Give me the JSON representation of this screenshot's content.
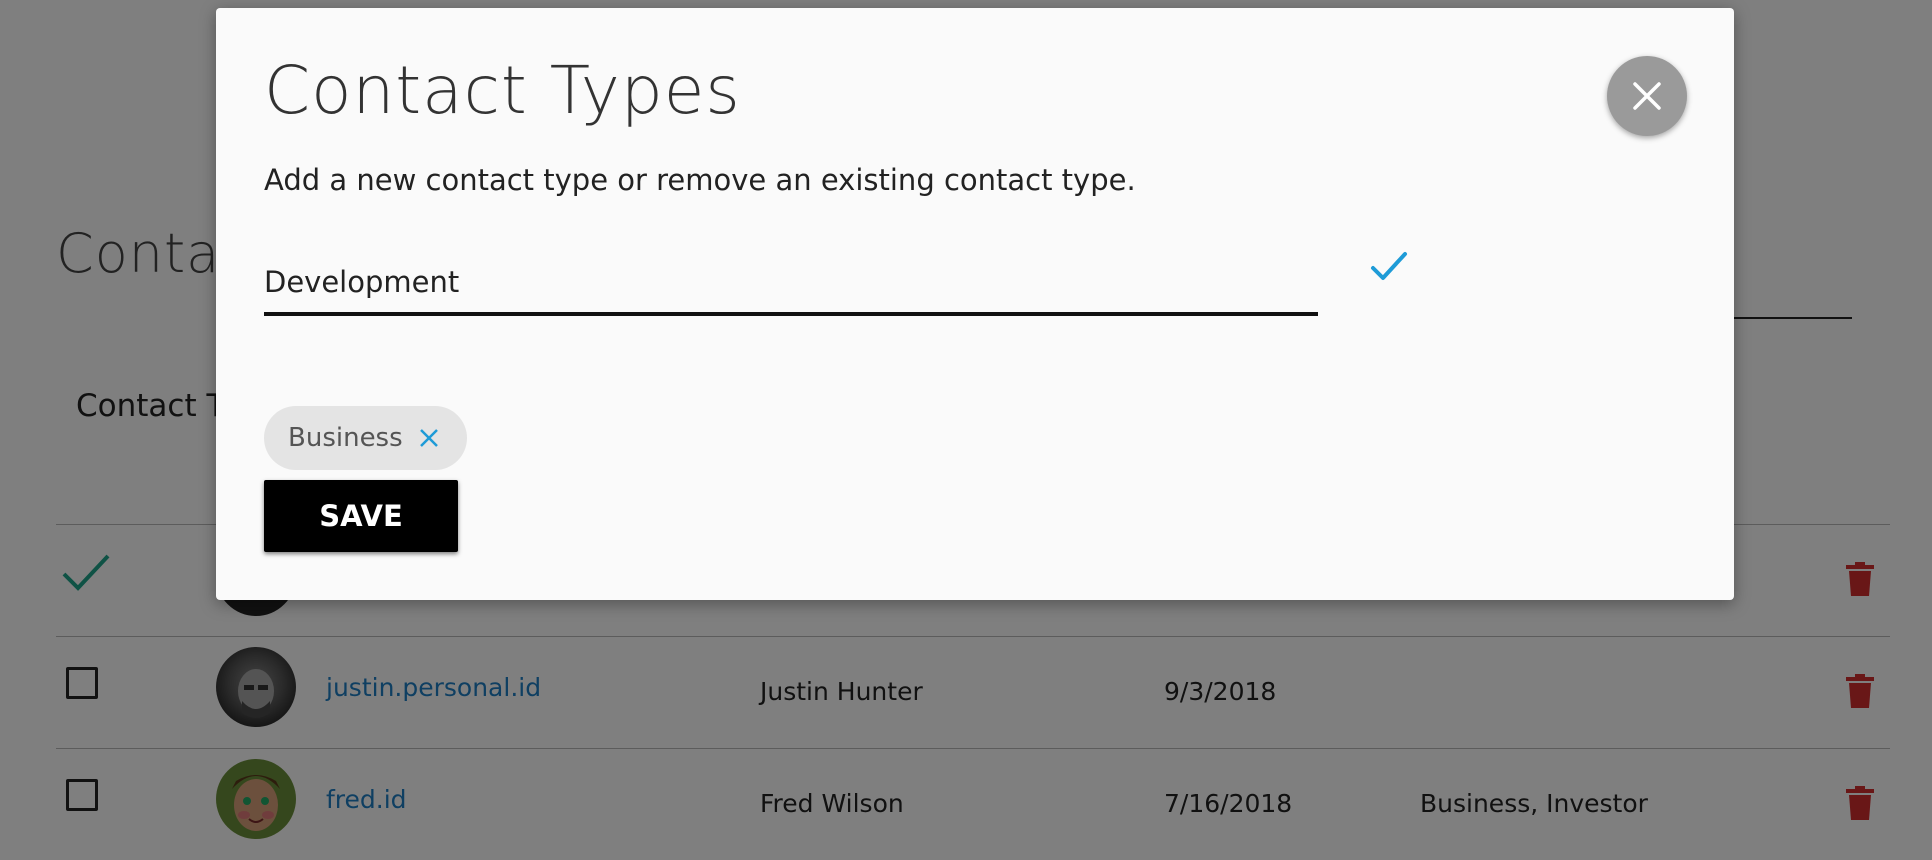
{
  "background": {
    "page_title": "Contacts",
    "column_header": "Contact Types",
    "rows": [
      {
        "username": "justin.personal.id",
        "name": "Justin Hunter",
        "date": "9/3/2018",
        "types": ""
      },
      {
        "username": "fred.id",
        "name": "Fred Wilson",
        "date": "7/16/2018",
        "types": "Business, Investor"
      }
    ]
  },
  "modal": {
    "title": "Contact Types",
    "description": "Add a new contact type or remove an existing contact type.",
    "input_value": "Development",
    "chips": [
      {
        "label": "Business"
      }
    ],
    "save_label": "SAVE"
  },
  "colors": {
    "accent": "#1e9bd7",
    "link": "#1e7fc4",
    "delete": "#d32f2f",
    "check": "#1ea58a",
    "save_button": "#000000",
    "close_button": "#9a9a9a"
  },
  "icons": {
    "close": "close-icon",
    "confirm": "checkmark-icon",
    "chip_remove": "close-icon",
    "row_delete": "trash-icon",
    "row_selected": "checkmark-icon"
  }
}
